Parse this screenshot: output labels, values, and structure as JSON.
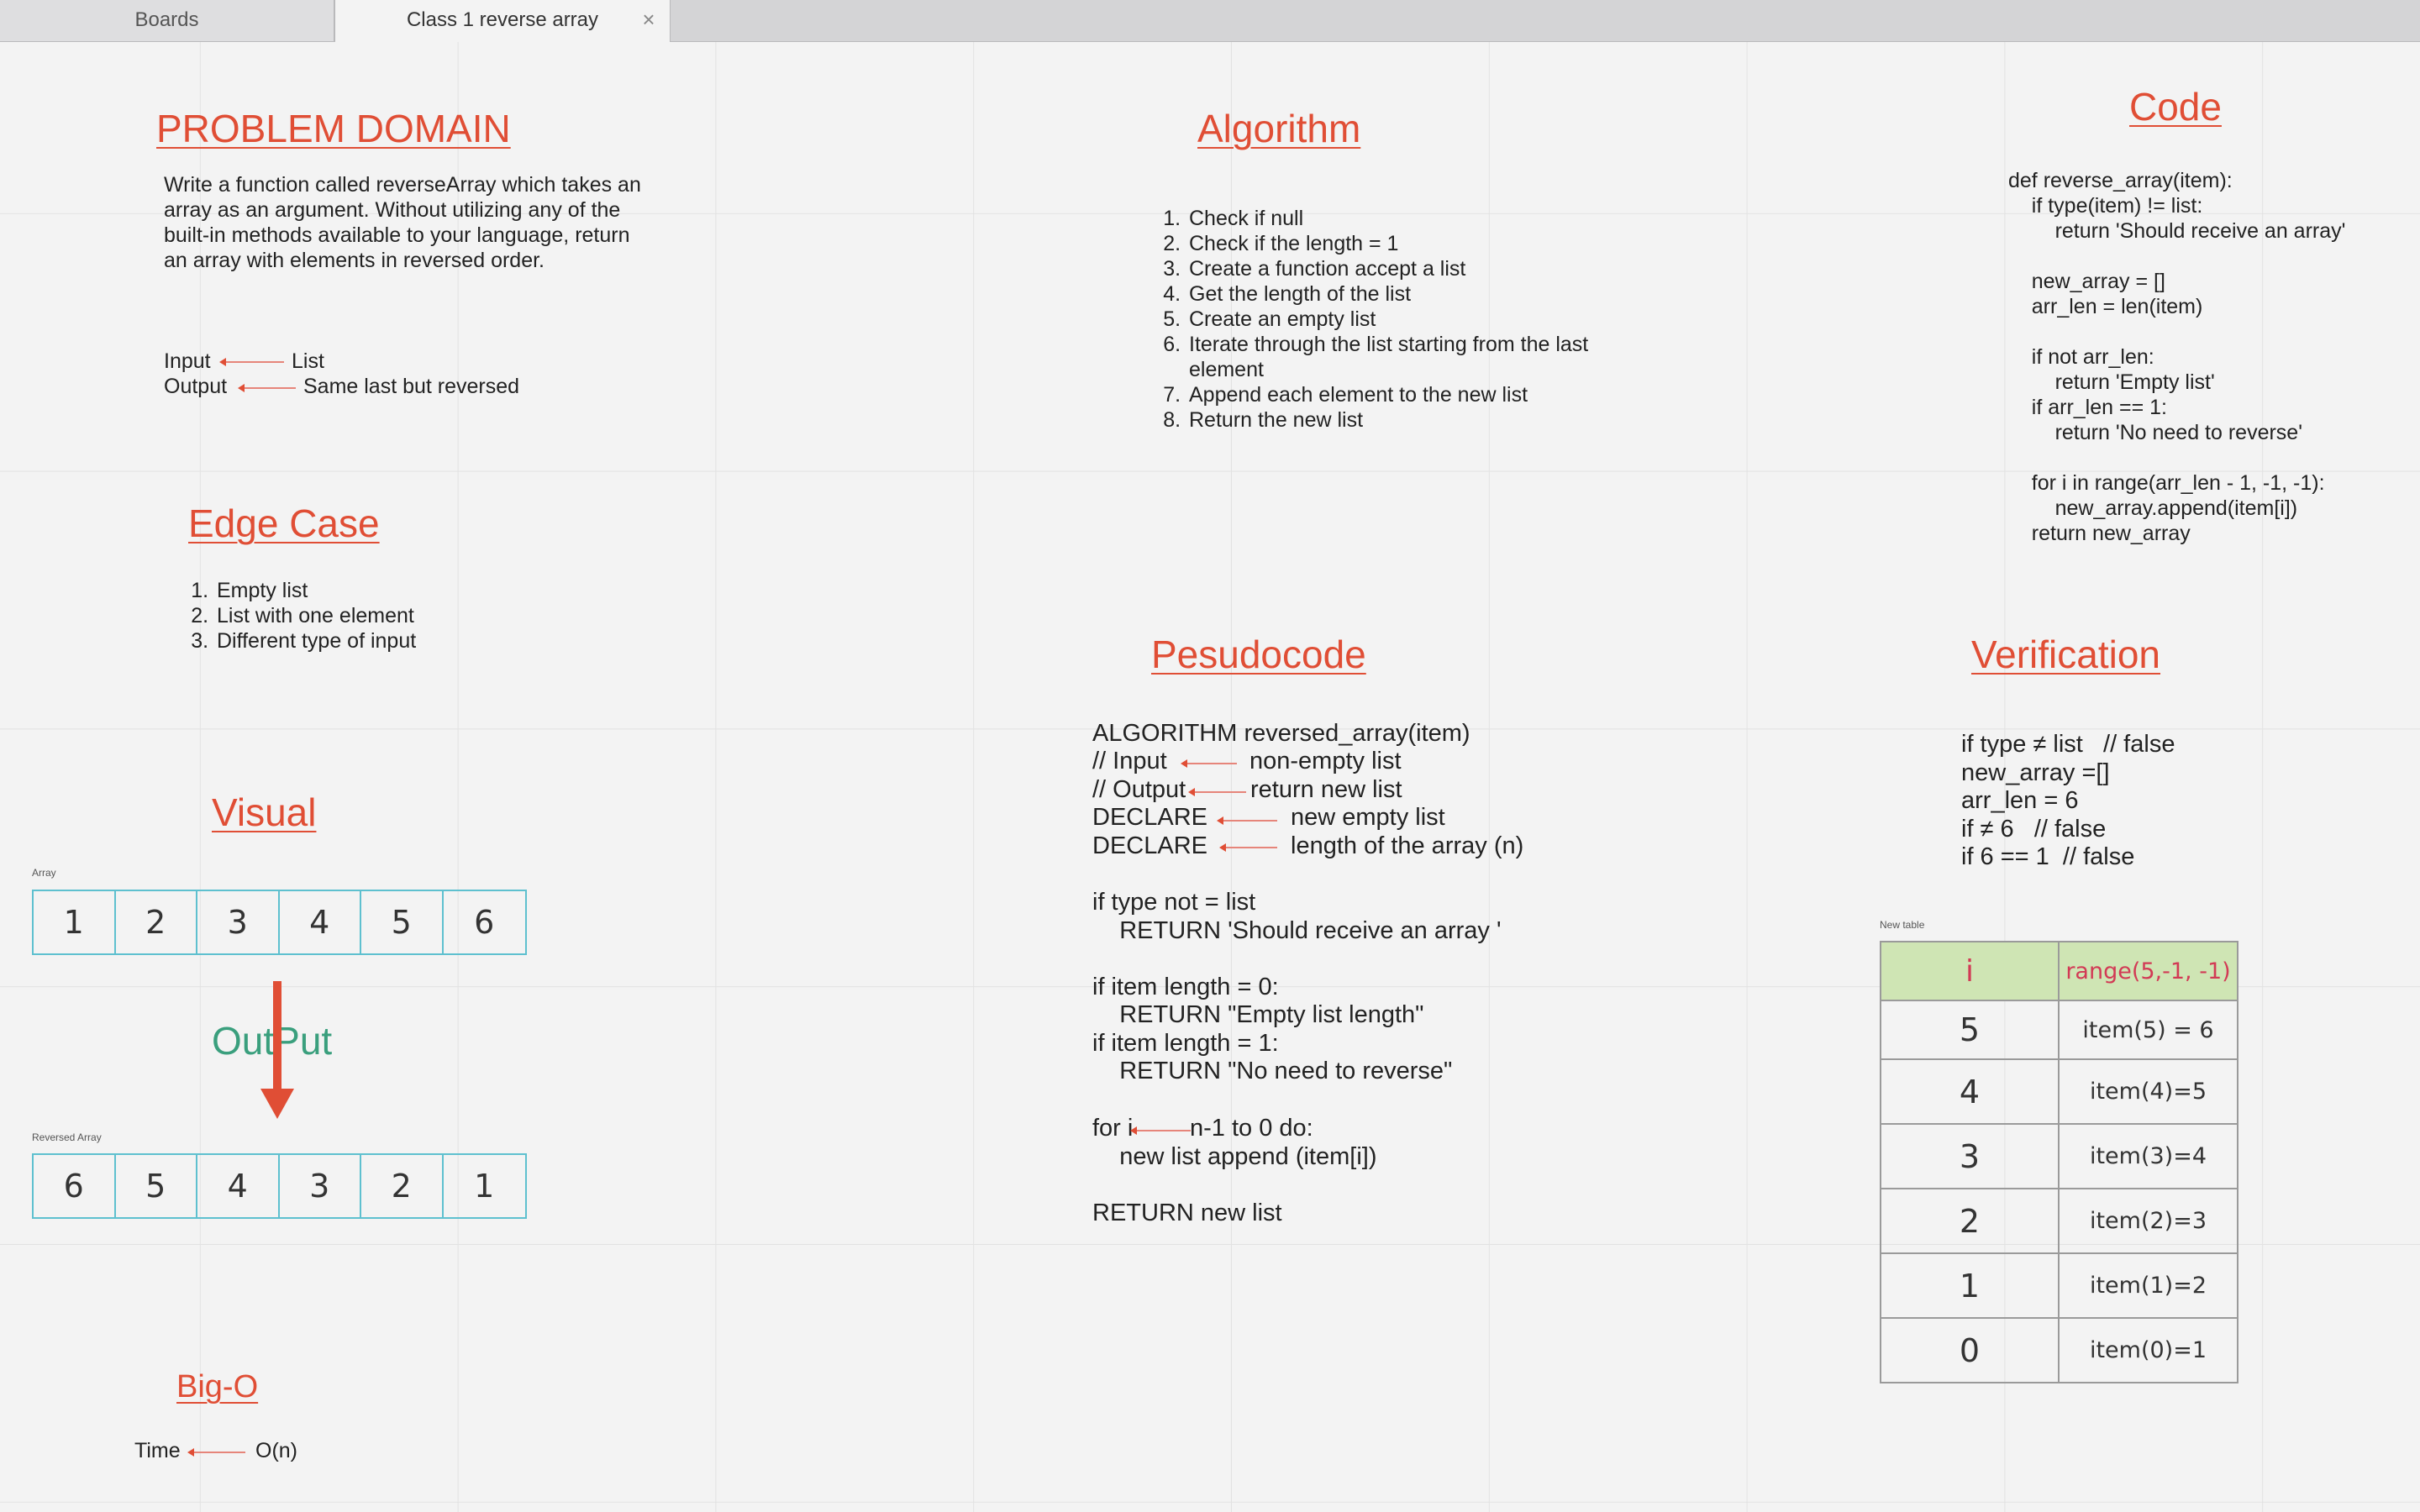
{
  "tabs": [
    {
      "label": "Boards",
      "active": false
    },
    {
      "label": "Class 1 reverse array",
      "active": true
    }
  ],
  "colors": {
    "heading": "#e04e35",
    "output_label": "#3a9f7d",
    "array_border": "#5ec0cf",
    "table_header_bg": "#cfe5b4",
    "table_header_text": "#d23a55"
  },
  "problem_domain": {
    "title": "PROBLEM DOMAIN",
    "description": "Write a function called reverseArray which takes an array as an argument. Without utilizing any of the built-in methods available to your language, return an array with elements in reversed order.",
    "input_label": "Input",
    "input_value": "List",
    "output_label": "Output",
    "output_value": "Same last but reversed"
  },
  "edge_case": {
    "title": "Edge Case",
    "items": [
      "Empty list",
      "List with one element",
      "Different type of input"
    ]
  },
  "visual": {
    "title": "Visual",
    "array_label": "Array",
    "array": [
      "1",
      "2",
      "3",
      "4",
      "5",
      "6"
    ],
    "output_label": "OutPut",
    "reversed_label": "Reversed Array",
    "reversed": [
      "6",
      "5",
      "4",
      "3",
      "2",
      "1"
    ]
  },
  "big_o": {
    "title": "Big-O",
    "time_label": "Time",
    "time_value": "O(n)"
  },
  "algorithm": {
    "title": "Algorithm",
    "steps": [
      "Check if null",
      "Check if the length = 1",
      "Create a function accept a list",
      "Get the length of the list",
      "Create an empty list",
      "Iterate through the list starting from the last element",
      "Append each element to the new list",
      "Return the new list"
    ]
  },
  "pseudocode": {
    "title": "Pesudocode",
    "line1": "ALGORITHM reversed_array(item)",
    "input_label": "// Input",
    "input_value": "non-empty list",
    "output_label": "// Output",
    "output_value": "return new list",
    "declare1_label": "DECLARE",
    "declare1_value": "new empty list",
    "declare2_label": "DECLARE",
    "declare2_value": "length of the array (n)",
    "block1": "if type not = list\n    RETURN 'Should receive an array '\n\nif item length = 0:\n    RETURN \"Empty list length\"\nif item length = 1:\n    RETURN \"No need to reverse\"",
    "for_label": "for i",
    "for_value": "n-1 to 0 do:",
    "for_body": "    new list append (item[i])",
    "return_line": "RETURN new list"
  },
  "code": {
    "title": "Code",
    "source": "def reverse_array(item):\n    if type(item) != list:\n        return 'Should receive an array'\n\n    new_array = []\n    arr_len = len(item)\n\n    if not arr_len:\n        return 'Empty list'\n    if arr_len == 1:\n        return 'No need to reverse'\n\n    for i in range(arr_len - 1, -1, -1):\n        new_array.append(item[i])\n    return new_array"
  },
  "verification": {
    "title": "Verification",
    "lines": "if type ≠ list   // false\nnew_array =[]\narr_len = 6\nif ≠ 6   // false\nif 6 == 1  // false",
    "table_label": "New table",
    "table_header": [
      "i",
      "range(5,-1, -1)"
    ],
    "table_rows": [
      [
        "5",
        "item(5) = 6"
      ],
      [
        "4",
        "item(4)=5"
      ],
      [
        "3",
        "item(3)=4"
      ],
      [
        "2",
        "item(2)=3"
      ],
      [
        "1",
        "item(1)=2"
      ],
      [
        "0",
        "item(0)=1"
      ]
    ]
  }
}
